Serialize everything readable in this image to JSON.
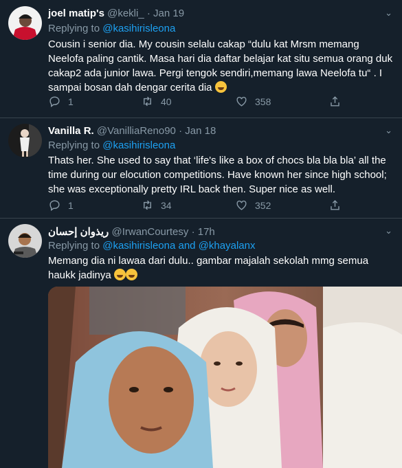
{
  "tweets": [
    {
      "name": "joel matip's",
      "handle": "@kekli_",
      "time": "Jan 19",
      "replying_prefix": "Replying to",
      "replying_to": "@kasihirisleona",
      "text": "Cousin i senior dia. My cousin selalu cakap “dulu kat Mrsm memang Neelofa paling cantik. Masa hari dia daftar belajar kat situ semua orang duk cakap2 ada junior lawa. Pergi tengok sendiri,memang lawa Neelofa tu“ . I sampai bosan dah dengar cerita dia",
      "replies": "1",
      "retweets": "40",
      "likes": "358"
    },
    {
      "name": "Vanilla R.",
      "handle": "@VanilliaReno90",
      "time": "Jan 18",
      "replying_prefix": "Replying to",
      "replying_to": "@kasihirisleona",
      "text": "Thats her. She used to say that ‘life's like a box of chocs bla bla bla’ all the time during our elocution competitions. Have known her since high school; she was exceptionally pretty IRL back then. Super nice as well.",
      "replies": "1",
      "retweets": "34",
      "likes": "352"
    },
    {
      "name": "ريذوان إحسان",
      "handle": "@IrwanCourtesy",
      "time": "17h",
      "replying_prefix": "Replying to",
      "replying_to": "@kasihirisleona and @khayalanx",
      "text": "Memang dia ni lawaa dari dulu.. gambar majalah sekolah mmg semua haukk jadinya"
    }
  ],
  "separator": "·",
  "colors": {
    "background": "#15202b",
    "accent": "#1da1f2",
    "muted": "#8899a6",
    "border": "#38444d"
  },
  "icons": [
    "reply-icon",
    "retweet-icon",
    "like-icon",
    "share-icon",
    "chevron-down-icon"
  ]
}
